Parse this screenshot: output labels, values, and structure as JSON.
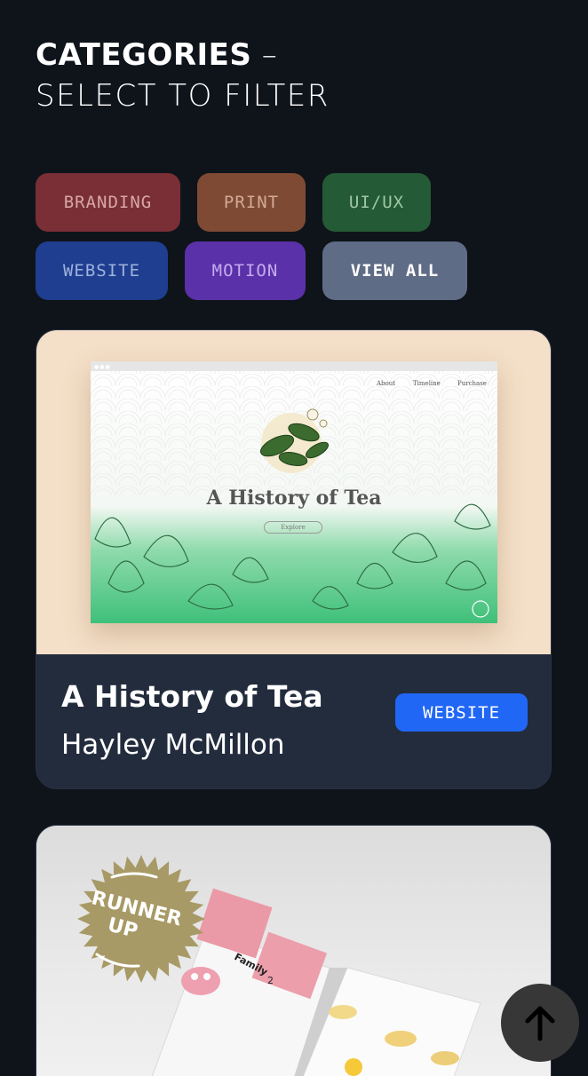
{
  "heading": {
    "bold": "CATEGORIES",
    "dash": " –",
    "subtitle": "SELECT TO FILTER"
  },
  "filters": [
    {
      "label": "BRANDING",
      "color": "#7a2e35",
      "text_color": "#d7a7a7"
    },
    {
      "label": "PRINT",
      "color": "#7f4a33",
      "text_color": "#d3aa97"
    },
    {
      "label": "UI/UX",
      "color": "#245a35",
      "text_color": "#9fc7a7"
    },
    {
      "label": "WEBSITE",
      "color": "#1f3e8f",
      "text_color": "#9fb2de"
    },
    {
      "label": "MOTION",
      "color": "#5a31a8",
      "text_color": "#c4acef"
    },
    {
      "label": "VIEW ALL",
      "color": "#5f6c86",
      "text_color": "#ffffff"
    }
  ],
  "projects": [
    {
      "title": "A History of Tea",
      "author": "Hayley McMillon",
      "category": "WEBSITE",
      "category_color": "#2167f5",
      "preview": {
        "title": "A History of Tea",
        "nav": [
          "About",
          "Timeline",
          "Purchase"
        ],
        "button": "Explore"
      }
    },
    {
      "award": "RUNNER UP",
      "award_lines": [
        "RUNNER",
        "UP"
      ],
      "award_color": "#a89a66",
      "preview_text": [
        "Family",
        "2"
      ]
    }
  ],
  "icons": {
    "back_to_top": "arrow-up-icon"
  }
}
